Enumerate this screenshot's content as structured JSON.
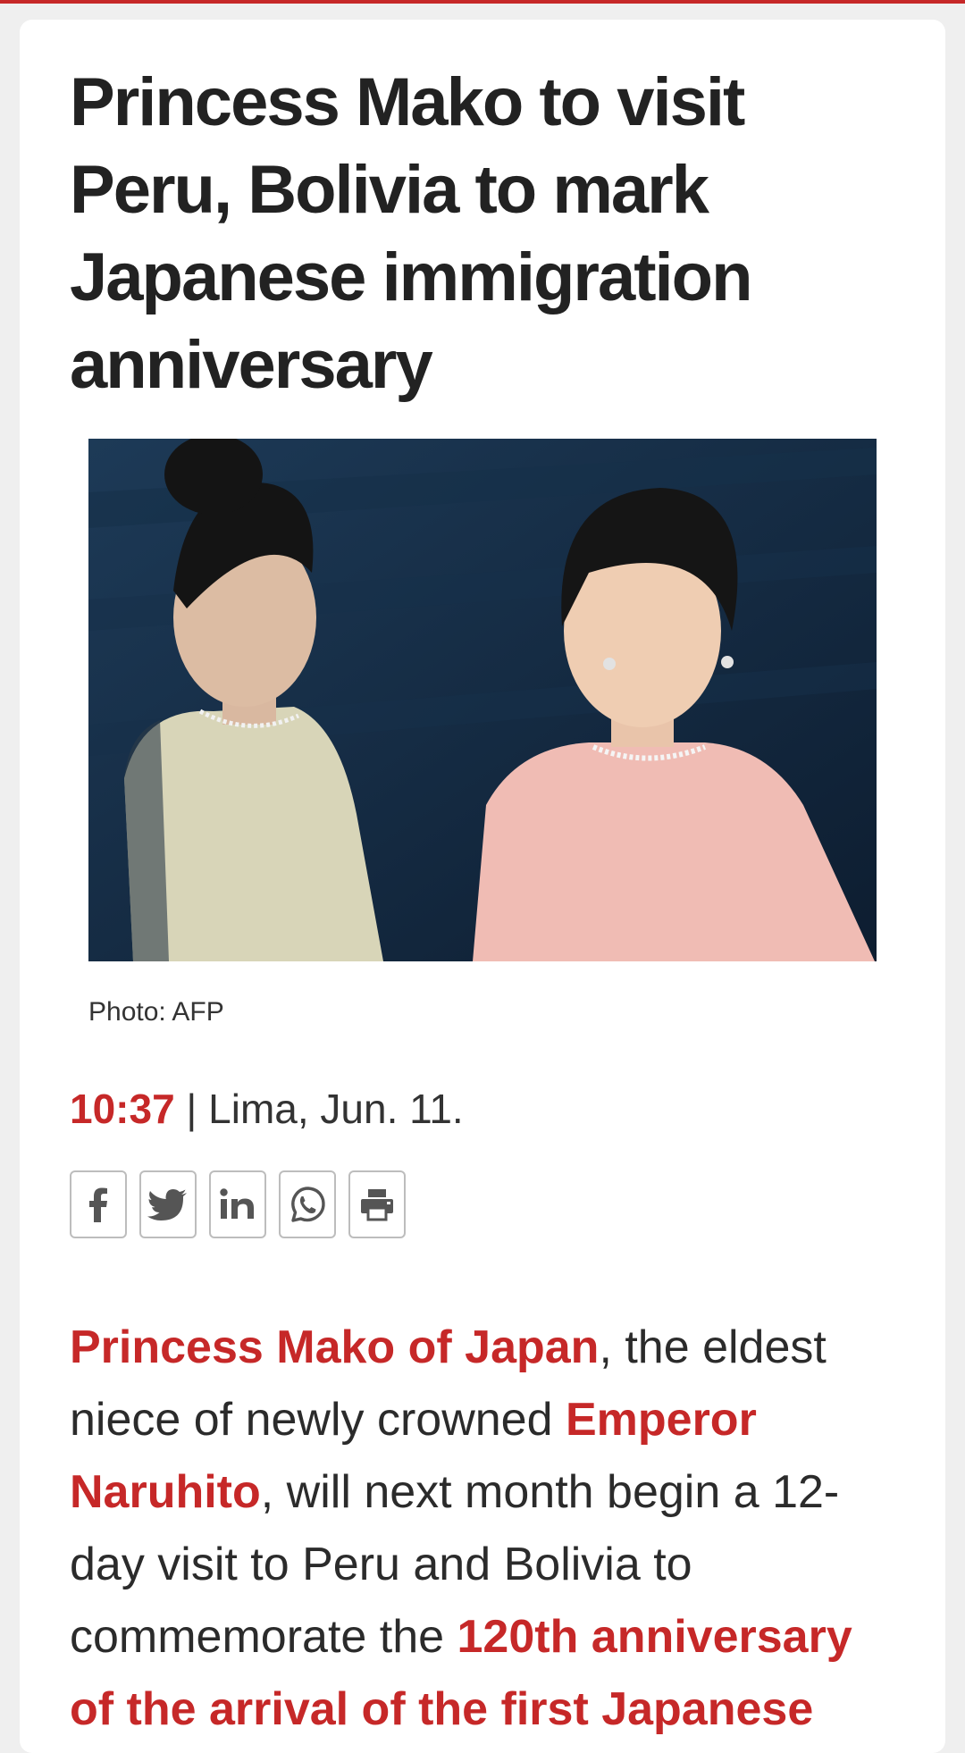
{
  "colors": {
    "accent": "#c62828",
    "text": "#222222",
    "background": "#efefef"
  },
  "article": {
    "headline": "Princess Mako to visit Peru, Bolivia to mark Japanese immigration anniversary",
    "photo_caption": "Photo: AFP",
    "time": "10:37",
    "separator": " | ",
    "dateline": "Lima, Jun. 11.",
    "body": {
      "hl1": "Princess Mako of Japan",
      "t1": ", the eldest niece of newly crowned ",
      "hl2": "Emperor Naruhito",
      "t2": ", will next month begin a 12-day visit to Peru and Bolivia to commemorate the ",
      "hl3": "120th anniversary of the arrival of the first Japanese"
    }
  },
  "share_buttons": [
    {
      "icon": "facebook-icon"
    },
    {
      "icon": "twitter-icon"
    },
    {
      "icon": "linkedin-icon"
    },
    {
      "icon": "whatsapp-icon"
    },
    {
      "icon": "print-icon"
    }
  ]
}
